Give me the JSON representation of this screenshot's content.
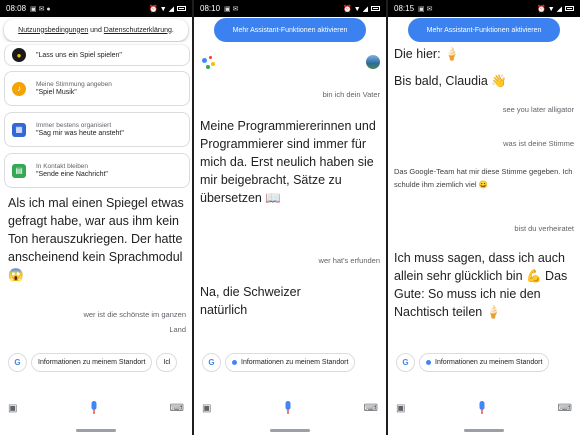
{
  "panes": [
    {
      "status_time": "08:08",
      "terms": {
        "part1": "Nutzungsbedingungen",
        "and": " und ",
        "part2": "Datenschutzerklärung",
        "end": "."
      },
      "cards": [
        {
          "icon": "game-icon",
          "color": "#1a1a1a",
          "glyph": "●",
          "sub": "",
          "main": "\"Lass uns ein Spiel spielen\""
        },
        {
          "icon": "music-icon",
          "color": "#f4a300",
          "glyph": "♪",
          "sub": "Meine Stimmung angeben",
          "main": "\"Spiel Musik\""
        },
        {
          "icon": "calendar-icon",
          "color": "#3367d6",
          "glyph": "▦",
          "sub": "Immer bestens organisiert",
          "main": "\"Sag mir was heute ansteht\""
        },
        {
          "icon": "message-icon",
          "color": "#34a853",
          "glyph": "▤",
          "sub": "In Kontakt bleiben",
          "main": "\"Sende eine Nachricht\""
        }
      ],
      "response": "Als ich mal einen Spiegel etwas gefragt habe, war aus ihm kein Ton herauszukriegen. Der hatte anscheinend kein Sprachmodul 😱",
      "user_query_1": "wer ist die schönste im ganzen",
      "user_query_2": "Land",
      "suggestion": "Informationen zu meinem Standort",
      "suggestion_cut": "Icl"
    },
    {
      "status_time": "08:10",
      "top_button": "Mehr Assistant-Funktionen aktivieren",
      "user_query": "bin ich dein Vater",
      "response": "Meine Programmiererinnen und Programmierer sind immer für mich da. Erst neulich haben sie mir beigebracht, Sätze zu übersetzen 📖",
      "user_query2": "wer hat's erfunden",
      "response2": "Na, die Schweizer natürlich",
      "suggestion": "Informationen zu meinem Standort"
    },
    {
      "status_time": "08:15",
      "top_button": "Mehr Assistant-Funktionen aktivieren",
      "top_text": "Die hier: 🍦",
      "line1": "Bis bald, Claudia 👋",
      "user_query1": "see you later alligator",
      "user_query2": "was ist deine Stimme",
      "mid_response": "Das Google-Team hat mir diese Stimme gegeben. Ich schulde ihm ziemlich viel 😀",
      "user_query3": "bist du verheiratet",
      "response": "Ich muss sagen, dass ich auch allein sehr glücklich bin 💪 Das Gute: So muss ich nie den Nachtisch teilen 🍦",
      "suggestion": "Informationen zu meinem Standort"
    }
  ],
  "colors": {
    "accent": "#3b82f0",
    "text": "#202124",
    "muted": "#5f6368"
  }
}
